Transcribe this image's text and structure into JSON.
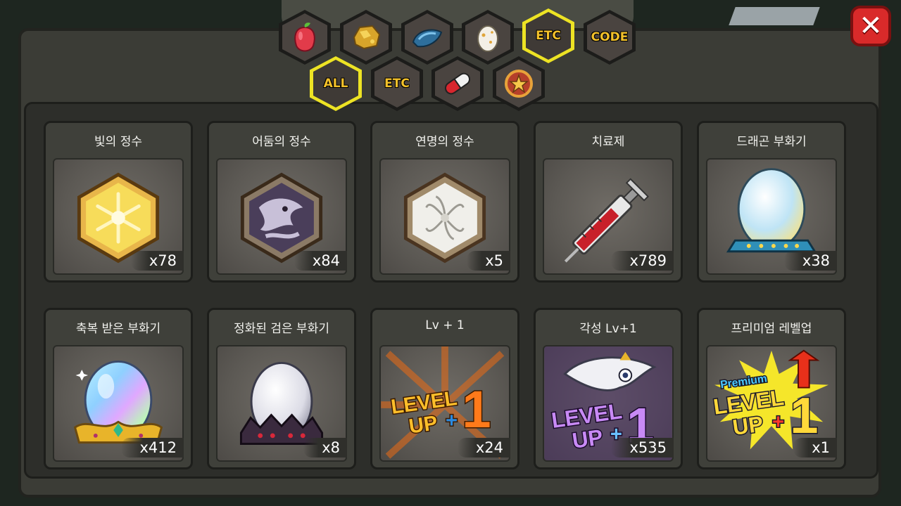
{
  "tabs_top": [
    {
      "type": "icon",
      "icon": "fruit-icon",
      "active": false
    },
    {
      "type": "icon",
      "icon": "gold-ore-icon",
      "active": false
    },
    {
      "type": "icon",
      "icon": "blue-stone-icon",
      "active": false
    },
    {
      "type": "icon",
      "icon": "egg-icon",
      "active": false
    },
    {
      "type": "text",
      "label": "ETC",
      "active": true
    },
    {
      "type": "text",
      "label": "CODE",
      "active": false
    }
  ],
  "tabs_sub": [
    {
      "type": "text",
      "label": "ALL",
      "active": true
    },
    {
      "type": "text",
      "label": "ETC",
      "active": false
    },
    {
      "type": "icon",
      "icon": "pill-icon",
      "active": false
    },
    {
      "type": "icon",
      "icon": "star-badge-icon",
      "active": false
    }
  ],
  "close_icon": "close-icon",
  "items": [
    {
      "title": "빛의 정수",
      "count": "x78",
      "icon": "light-essence-icon"
    },
    {
      "title": "어둠의 정수",
      "count": "x84",
      "icon": "dark-essence-icon"
    },
    {
      "title": "연명의 정수",
      "count": "x5",
      "icon": "life-essence-icon"
    },
    {
      "title": "치료제",
      "count": "x789",
      "icon": "syringe-icon"
    },
    {
      "title": "드래곤 부화기",
      "count": "x38",
      "icon": "dragon-incubator-icon"
    },
    {
      "title": "축복 받은 부화기",
      "count": "x412",
      "icon": "blessed-incubator-icon"
    },
    {
      "title": "정화된 검은 부화기",
      "count": "x8",
      "icon": "purified-black-incubator-icon"
    },
    {
      "title": "Lv + 1",
      "count": "x24",
      "icon": "level-up-icon",
      "art_text": [
        "LEVEL",
        "UP",
        "+",
        "1"
      ]
    },
    {
      "title": "각성 Lv+1",
      "count": "x535",
      "icon": "awaken-level-up-icon",
      "art_text": [
        "LEVEL",
        "UP",
        "+",
        "1"
      ]
    },
    {
      "title": "프리미엄 레벨업",
      "count": "x1",
      "icon": "premium-level-up-icon",
      "art_text": [
        "Premium",
        "LEVEL",
        "UP",
        "+",
        "1"
      ]
    }
  ],
  "colors": {
    "accent": "#ede324",
    "tab_text": "#f3c12a",
    "close": "#d92a2a"
  }
}
